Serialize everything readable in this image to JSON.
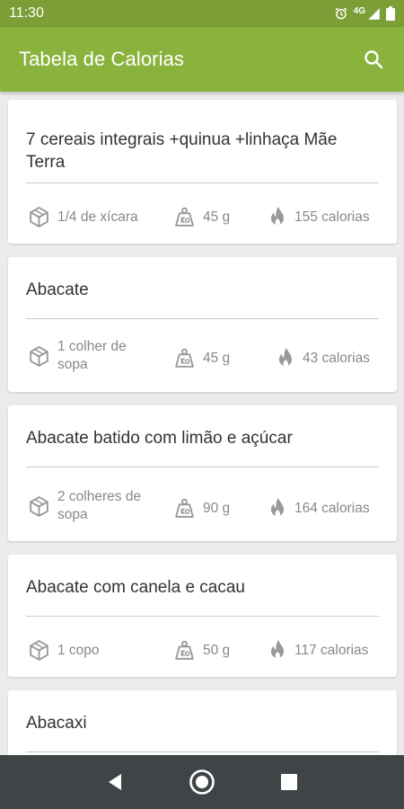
{
  "status_bar": {
    "time": "11:30",
    "network": "4G"
  },
  "app_bar": {
    "title": "Tabela de Calorias"
  },
  "foods": [
    {
      "name": "7 cereais integrais +quinua +linhaça Mãe Terra",
      "portion": "1/4 de xícara",
      "weight": "45 g",
      "calories": "155 calorias"
    },
    {
      "name": "Abacate",
      "portion": "1 colher de sopa",
      "weight": "45 g",
      "calories": "43 calorias"
    },
    {
      "name": "Abacate batido com limão e açúcar",
      "portion": "2 colheres de sopa",
      "weight": "90 g",
      "calories": "164 calorias"
    },
    {
      "name": "Abacate com canela e cacau",
      "portion": "1 copo",
      "weight": "50 g",
      "calories": "117 calorias"
    },
    {
      "name": "Abacaxi",
      "portion": "",
      "weight": "",
      "calories": ""
    }
  ],
  "colors": {
    "status_bar": "#7c9e36",
    "app_bar": "#8ab33e",
    "nav_bar": "#3f4447"
  },
  "icons": {
    "portion": "cube-icon",
    "weight": "scale-weight-icon",
    "calories": "flame-icon",
    "search": "search-icon"
  }
}
